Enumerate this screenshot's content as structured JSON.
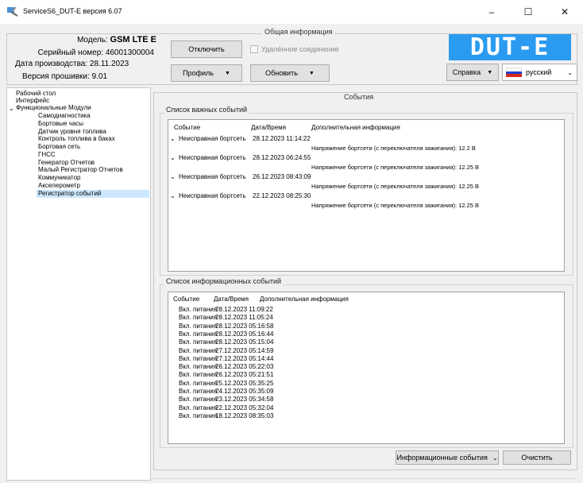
{
  "window": {
    "title": "ServiceS6_DUT-E версия 6.07",
    "icon": "tools-icon",
    "min_glyph": "–",
    "max_glyph": "☐",
    "close_glyph": "✕"
  },
  "header": {
    "group_title": "Общая информация",
    "model_label": "Модель:",
    "model_value": "GSM LTE E",
    "serial_label": "Серийный номер:",
    "serial_value": "46001300004",
    "date_label": "Дата производства:",
    "date_value": "28.11.2023",
    "firmware_label": "Версия прошивки:",
    "firmware_value": "9.01",
    "disconnect_label": "Отключить",
    "remote_label": "Удалённое соединение",
    "profile_label": "Профиль",
    "update_label": "Обновить",
    "help_label": "Справка",
    "logo_text": "DUT-E",
    "logo_color": "#2a9bf0",
    "language_value": "русский",
    "flag_colors": [
      "#ffffff",
      "#1c3fd0",
      "#d52b1e"
    ]
  },
  "tree": {
    "items": [
      "Рабочий стол",
      "Интерфейс",
      "Функциональные Модули",
      "Самодиагностика",
      "Бортовые часы",
      "Датчик уровня топлива",
      "Контроль топлива в баках",
      "Бортовая сеть",
      "ГНСС",
      "Генератор Отчетов",
      "Малый Регистратор Отчетов",
      "Коммуникатор",
      "Акселерометр",
      "Регистратор событий"
    ],
    "selected": "Регистратор событий"
  },
  "events": {
    "title": "События",
    "important": {
      "group_title": "Список важных событий",
      "col_event": "Событие",
      "col_date": "Дата/Время",
      "col_info": "Дополнительная информация",
      "rows": [
        {
          "event": "Неисправная бортсеть",
          "date": "28.12.2023 11:14:22",
          "info": "Напряжение бортсети (с переключателя зажигания): 12.2 В"
        },
        {
          "event": "Неисправная бортсеть",
          "date": "28.12.2023 06:24:55",
          "info": "Напряжение бортсети (с переключателя зажигания): 12.25 В"
        },
        {
          "event": "Неисправная бортсеть",
          "date": "26.12.2023 08:43:09",
          "info": "Напряжение бортсети (с переключателя зажигания): 12.25 В"
        },
        {
          "event": "Неисправная бортсеть",
          "date": "22.12.2023 08:25:30",
          "info": "Напряжение бортсети (с переключателя зажигания): 12.25 В"
        }
      ]
    },
    "informational": {
      "group_title": "Список информационных событий",
      "col_event": "Событие",
      "col_date": "Дата/Время",
      "col_info": "Дополнительная информация",
      "rows": [
        {
          "event": "Вкл. питания",
          "date": "28.12.2023 11:09:22"
        },
        {
          "event": "Вкл. питания",
          "date": "28.12.2023 11:05:24"
        },
        {
          "event": "Вкл. питания",
          "date": "28.12.2023 05:16:58"
        },
        {
          "event": "Вкл. питания",
          "date": "28.12.2023 05:16:44"
        },
        {
          "event": "Вкл. питания",
          "date": "28.12.2023 05:15:04"
        },
        {
          "event": "Вкл. питания",
          "date": "27.12.2023 05:14:59"
        },
        {
          "event": "Вкл. питания",
          "date": "27.12.2023 05:14:44"
        },
        {
          "event": "Вкл. питания",
          "date": "26.12.2023 05:22:03"
        },
        {
          "event": "Вкл. питания",
          "date": "26.12.2023 05:21:51"
        },
        {
          "event": "Вкл. питания",
          "date": "25.12.2023 05:35:25"
        },
        {
          "event": "Вкл. питания",
          "date": "24.12.2023 05:35:09"
        },
        {
          "event": "Вкл. питания",
          "date": "23.12.2023 05:34:58"
        },
        {
          "event": "Вкл. питания",
          "date": "22.12.2023 05:32:04"
        },
        {
          "event": "Вкл. питания",
          "date": "18.12.2023 08:35:03"
        }
      ]
    },
    "filter_value": "Информационные события",
    "clear_label": "Очистить"
  }
}
